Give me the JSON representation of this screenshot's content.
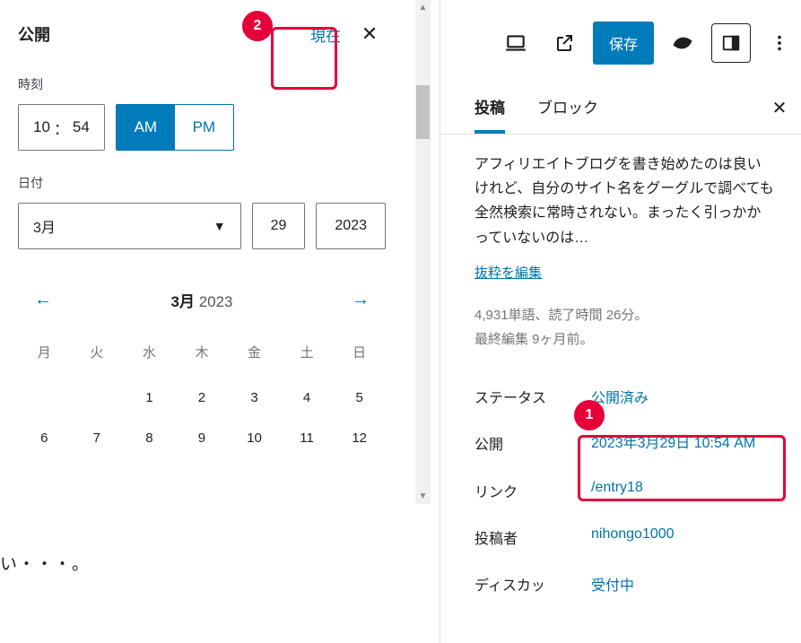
{
  "popover": {
    "title": "公開",
    "now_link": "現在",
    "time_label": "時刻",
    "time": {
      "hour": "10",
      "sep": "：",
      "minute": "54"
    },
    "ampm": {
      "am": "AM",
      "pm": "PM",
      "selected": "AM"
    },
    "date_label": "日付",
    "month_select": "3月",
    "day": "29",
    "year": "2023",
    "cal": {
      "month": "3月",
      "year": "2023",
      "dow": [
        "月",
        "火",
        "水",
        "木",
        "金",
        "土",
        "日"
      ],
      "rows": [
        [
          "",
          "",
          "1",
          "2",
          "3",
          "4",
          "5"
        ],
        [
          "6",
          "7",
          "8",
          "9",
          "10",
          "11",
          "12"
        ]
      ]
    }
  },
  "body_text": "い・・・。",
  "body_text_2": "",
  "toolbar": {
    "save": "保存"
  },
  "tabs": {
    "post": "投稿",
    "block": "ブロック"
  },
  "inspector": {
    "excerpt": "アフィリエイトブログを書き始めたのは良いけれど、自分のサイト名をグーグルで調べても全然検索に常時されない。まったく引っかかっていないのは…",
    "edit_excerpt": "抜粋を編集",
    "stats": "4,931単語、読了時間 26分。",
    "last_edit": "最終編集 9ヶ月前。",
    "rows": {
      "status": {
        "label": "ステータス",
        "value": "公開済み"
      },
      "publish": {
        "label": "公開",
        "value": "2023年3月29日 10:54 AM"
      },
      "link": {
        "label": "リンク",
        "value": "/entry18"
      },
      "author": {
        "label": "投稿者",
        "value": "nihongo1000"
      },
      "discuss": {
        "label": "ディスカッ",
        "value": "受付中"
      }
    }
  },
  "callouts": {
    "1": "1",
    "2": "2"
  }
}
